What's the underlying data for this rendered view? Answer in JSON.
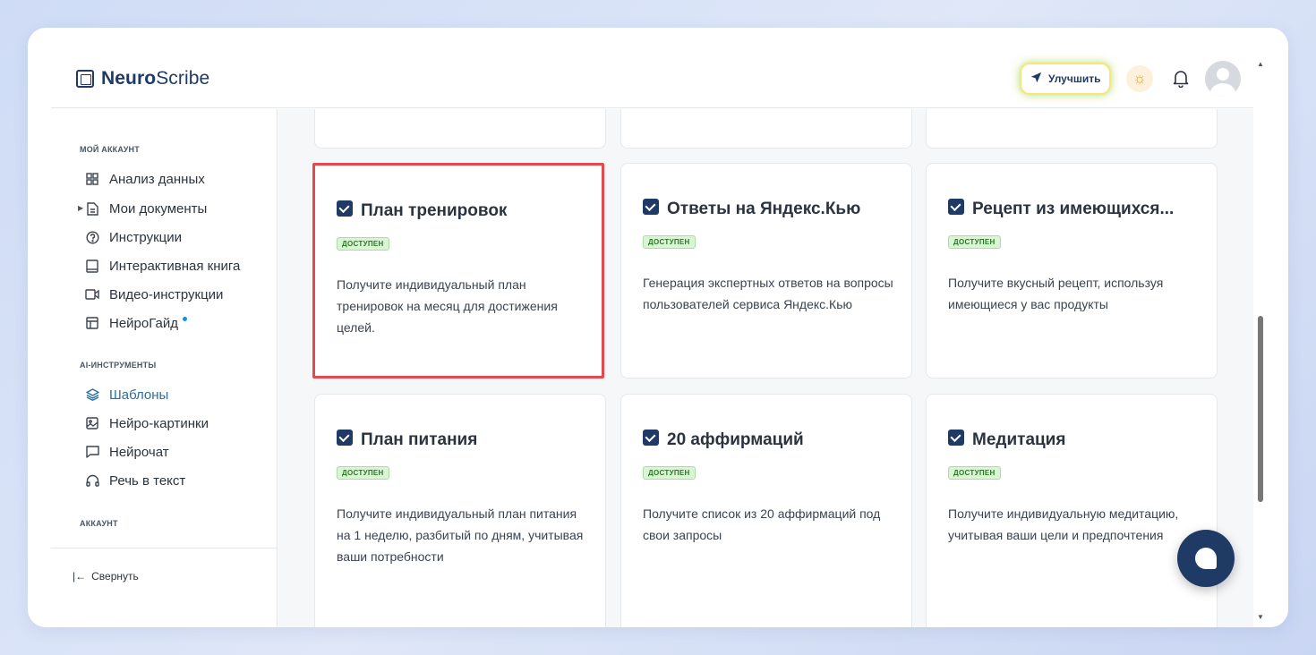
{
  "app": {
    "logo_bold": "Neuro",
    "logo_rest": "Scribe"
  },
  "header": {
    "upgrade_label": "Улучшить"
  },
  "sidebar": {
    "section_account": "МОЙ АККАУНТ",
    "items_account": [
      {
        "label": "Анализ данных",
        "icon": "grid-icon"
      },
      {
        "label": "Мои документы",
        "icon": "document-icon"
      },
      {
        "label": "Инструкции",
        "icon": "help-circle-icon"
      },
      {
        "label": "Интерактивная книга",
        "icon": "book-icon"
      },
      {
        "label": "Видео-инструкции",
        "icon": "video-icon"
      },
      {
        "label": "НейроГайд",
        "icon": "layout-icon"
      }
    ],
    "section_ai": "AI-ИНСТРУМЕНТЫ",
    "items_ai": [
      {
        "label": "Шаблоны",
        "icon": "layers-icon",
        "active": true
      },
      {
        "label": "Нейро-картинки",
        "icon": "image-icon"
      },
      {
        "label": "Нейрочат",
        "icon": "chat-icon"
      },
      {
        "label": "Речь в текст",
        "icon": "headphones-icon"
      }
    ],
    "section_acc2": "АККАУНТ",
    "collapse_label": "Свернуть"
  },
  "cards": [
    {
      "title": "План тренировок",
      "badge": "ДОСТУПЕН",
      "desc": "Получите индивидуальный план тренировок на месяц для достижения целей."
    },
    {
      "title": "Ответы на Яндекс.Кью",
      "badge": "ДОСТУПЕН",
      "desc": "Генерация экспертных ответов на вопросы пользователей сервиса Яндекс.Кью"
    },
    {
      "title": "Рецепт из имеющихся...",
      "badge": "ДОСТУПЕН",
      "desc": "Получите вкусный рецепт, используя имеющиеся у вас продукты"
    },
    {
      "title": "План питания",
      "badge": "ДОСТУПЕН",
      "desc": "Получите индивидуальный план питания на 1 неделю, разбитый по дням, учитывая ваши потребности"
    },
    {
      "title": "20 аффирмаций",
      "badge": "ДОСТУПЕН",
      "desc": "Получите список из 20 аффирмаций под свои запросы"
    },
    {
      "title": "Медитация",
      "badge": "ДОСТУПЕН",
      "desc": "Получите индивидуальную медитацию, учитывая ваши цели и предпочтения"
    }
  ],
  "colors": {
    "accent": "#1f3a64",
    "highlight": "#e5484d",
    "badge_bg": "#d9f5d4",
    "active_nav": "#2a6f9e"
  }
}
